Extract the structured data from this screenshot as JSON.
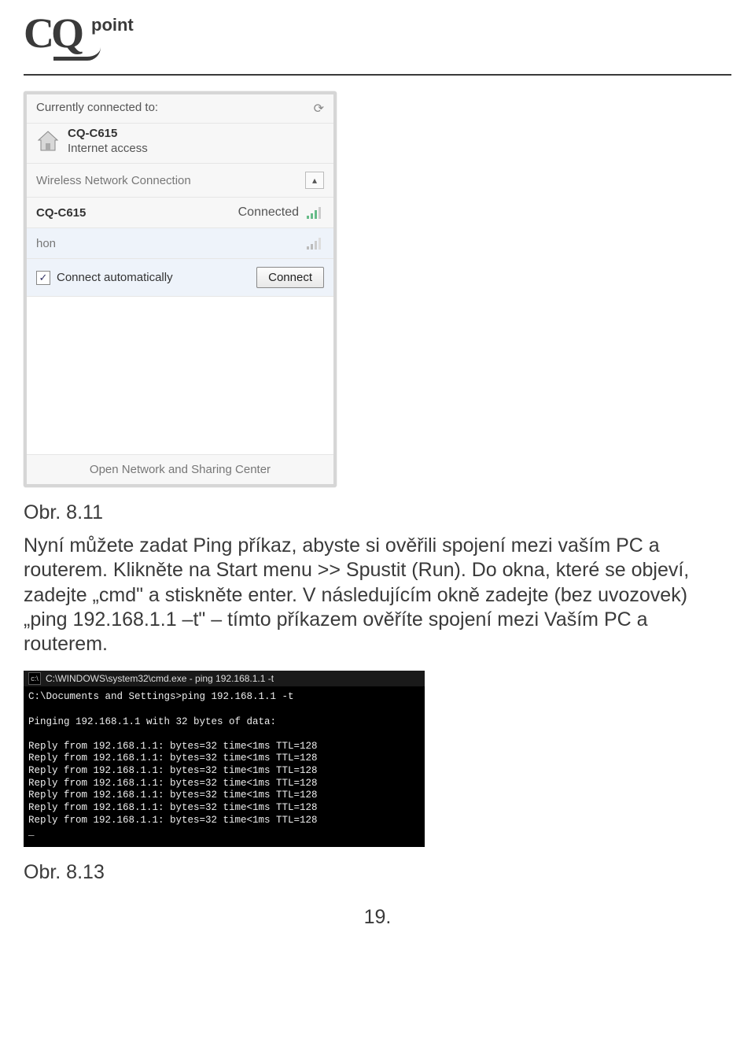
{
  "logo": {
    "cq": "CQ",
    "point": "point"
  },
  "wireless": {
    "currently_connected": "Currently connected to:",
    "network_name": "CQ-C615",
    "access": "Internet access",
    "wnc_label": "Wireless Network Connection",
    "net1_name": "CQ-C615",
    "net1_status": "Connected",
    "net2_name": "hon",
    "connect_auto": "Connect automatically",
    "connect_btn": "Connect",
    "footer": "Open Network and Sharing Center",
    "refresh_icon": "⟳"
  },
  "caption1": "Obr. 8.11",
  "body": "Nyní můžete zadat Ping příkaz, abyste si ověřili spojení mezi vaším PC a routerem. Klikněte na Start menu >> Spustit (Run). Do okna, které se objeví, zadejte „cmd\" a stiskněte enter. V následujícím okně zadejte (bez uvozovek) „ping 192.168.1.1 –t\" – tímto příkazem ověříte spojení mezi Vaším PC a routerem.",
  "cmd": {
    "title": "C:\\WINDOWS\\system32\\cmd.exe - ping 192.168.1.1 -t",
    "prompt": "C:\\Documents and Settings>ping 192.168.1.1 -t",
    "pinging": "Pinging 192.168.1.1 with 32 bytes of data:",
    "reply": "Reply from 192.168.1.1: bytes=32 time<1ms TTL=128",
    "cursor": "_"
  },
  "caption2": "Obr. 8.13",
  "page_num": "19."
}
